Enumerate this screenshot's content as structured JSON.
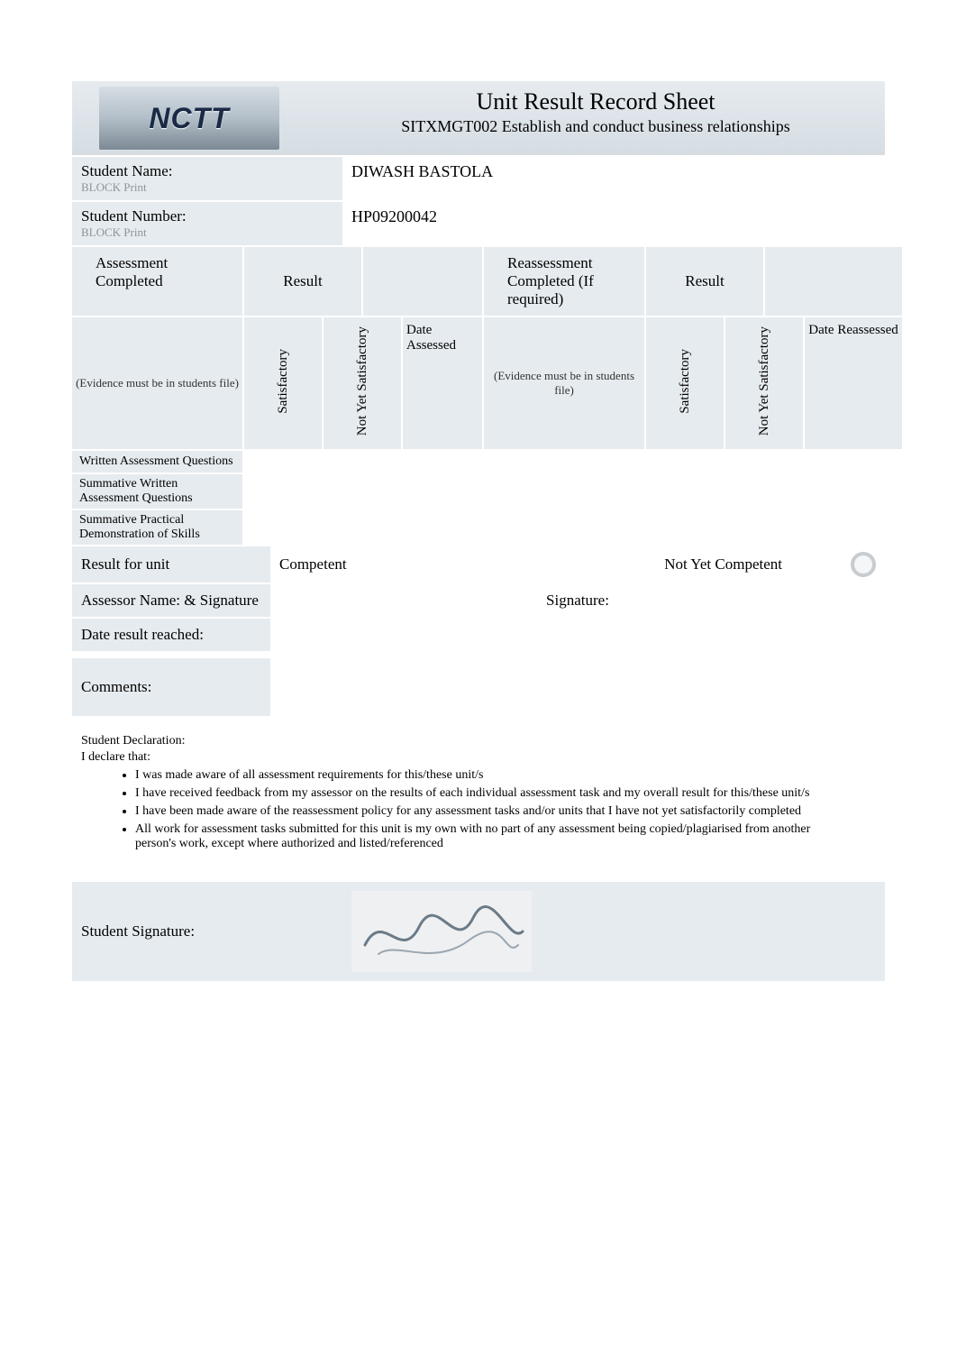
{
  "header": {
    "title": "Unit Result Record Sheet",
    "unit_code_name": "SITXMGT002 Establish and conduct business relationships",
    "logo_text": "NCTT"
  },
  "fields": {
    "student_name_label": "Student Name:",
    "block_print": "BLOCK Print",
    "student_name_value": "DIWASH BASTOLA",
    "student_number_label": "Student Number:",
    "student_number_value": "HP09200042"
  },
  "assess_headers": {
    "assessment_completed": "Assessment Completed",
    "result": "Result",
    "reassessment_completed": "Reassessment Completed (If required)",
    "evidence_note": "(Evidence must be in students file)",
    "satisfactory": "Satisfactory",
    "not_yet_satisfactory": "Not Yet Satisfactory",
    "date_assessed": "Date Assessed",
    "date_reassessed": "Date Reassessed"
  },
  "assess_rows": [
    {
      "label": "Written Assessment Questions"
    },
    {
      "label": "Summative Written Assessment Questions"
    },
    {
      "label": "Summative Practical Demonstration of Skills"
    }
  ],
  "result_unit": {
    "label": "Result for unit",
    "competent": "Competent",
    "not_yet_competent": "Not Yet Competent"
  },
  "assessor": {
    "label": "Assessor Name: & Signature",
    "signature_label": "Signature:"
  },
  "date_result": {
    "label": "Date result reached:"
  },
  "comments": {
    "label": "Comments:"
  },
  "declaration": {
    "title": "Student Declaration:",
    "intro": "I declare that:",
    "items": [
      "I was made aware of all assessment requirements for this/these unit/s",
      "I have received feedback from my assessor on the results of each individual assessment task and my overall result for this/these unit/s",
      "I have been made aware of the reassessment policy for any assessment tasks and/or units that I have not yet satisfactorily completed",
      "All work for assessment tasks submitted for this unit is my own with no part of any assessment being copied/plagiarised from another person's work, except where authorized and listed/referenced"
    ]
  },
  "student_signature": {
    "label": "Student Signature:"
  }
}
